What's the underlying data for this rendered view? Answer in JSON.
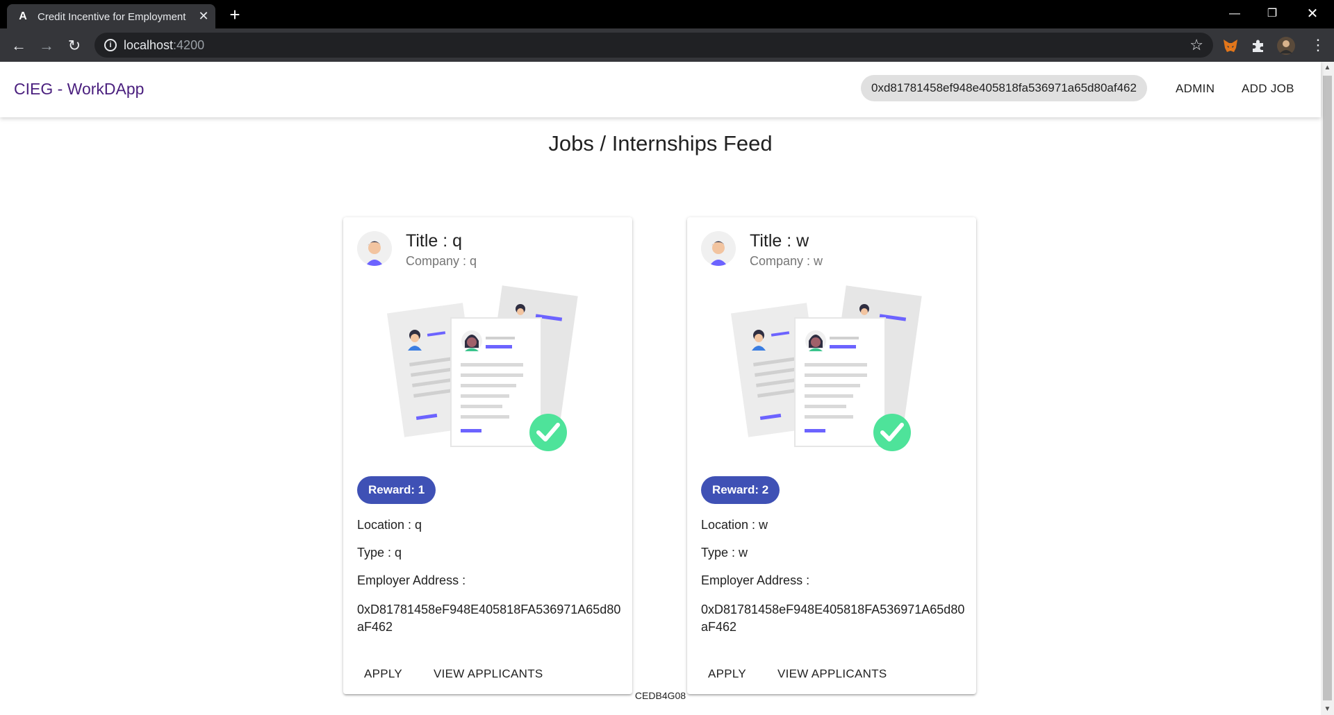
{
  "browser": {
    "tab_title": "Credit Incentive for Employment",
    "tab_favicon": "A",
    "url_host": "localhost",
    "url_port": ":4200"
  },
  "app": {
    "brand": "CIEG - WorkDApp",
    "wallet_address": "0xd81781458ef948e405818fa536971a65d80af462",
    "nav": {
      "admin": "ADMIN",
      "add_job": "ADD JOB"
    },
    "feed_title": "Jobs / Internships Feed",
    "footer_code": "CEDB4G08"
  },
  "jobs": [
    {
      "title": "Title : q",
      "company": "Company : q",
      "reward": "Reward: 1",
      "location": "Location : q",
      "type": "Type : q",
      "employer_label": "Employer Address :",
      "employer_address": "0xD81781458eF948E405818FA536971A65d80aF462",
      "apply": "APPLY",
      "view_applicants": "VIEW APPLICANTS"
    },
    {
      "title": "Title : w",
      "company": "Company : w",
      "reward": "Reward: 2",
      "location": "Location : w",
      "type": "Type : w",
      "employer_label": "Employer Address :",
      "employer_address": "0xD81781458eF948E405818FA536971A65d80aF462",
      "apply": "APPLY",
      "view_applicants": "VIEW APPLICANTS"
    }
  ],
  "icons": {
    "back": "arrow-left-icon",
    "forward": "arrow-right-icon",
    "reload": "reload-icon",
    "site_info": "info-icon",
    "bookmark": "star-icon",
    "metamask": "fox-icon",
    "extensions": "puzzle-icon",
    "profile": "avatar-icon",
    "menu": "kebab-icon"
  },
  "colors": {
    "brand": "#4a1f7e",
    "reward_chip": "#3f51b5",
    "check": "#4ee39a",
    "accent_line": "#6c63ff"
  }
}
